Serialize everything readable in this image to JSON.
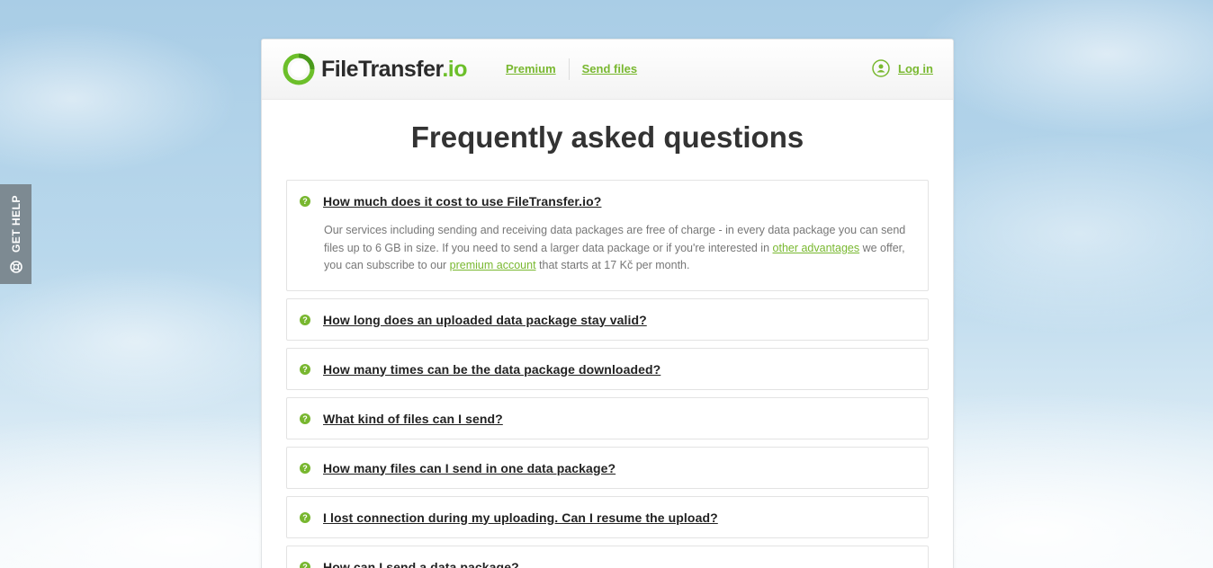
{
  "help_tab": {
    "label": "GET HELP",
    "icon": "lifebuoy-icon"
  },
  "header": {
    "logo_text_main": "FileTransfer",
    "logo_text_suffix": ".io",
    "nav": [
      {
        "label": "Premium"
      },
      {
        "label": "Send files"
      }
    ],
    "login_label": "Log in",
    "login_icon": "user-icon"
  },
  "colors": {
    "accent_green": "#79b830",
    "title_text": "#333333",
    "help_tab_bg": "#7d8a92"
  },
  "main": {
    "title": "Frequently asked questions",
    "faq": [
      {
        "question": "How much does it cost to use FileTransfer.io?",
        "answer": {
          "part1": "Our services including sending and receiving data packages are free of charge - in every data package you can send files up to 6 GB in size. If you need to send a larger data package or if you're interested in ",
          "link1": "other advantages",
          "part2": " we offer, you can subscribe to our ",
          "link2": "premium account",
          "part3": " that starts at 17 Kč per month."
        }
      },
      {
        "question": "How long does an uploaded data package stay valid?"
      },
      {
        "question": "How many times can be the data package downloaded?"
      },
      {
        "question": "What kind of files can I send?"
      },
      {
        "question": "How many files can I send in one data package?"
      },
      {
        "question": "I lost connection during my uploading. Can I resume the upload?"
      },
      {
        "question": "How can I send a data package?"
      }
    ],
    "question_icon_glyph": "?"
  }
}
